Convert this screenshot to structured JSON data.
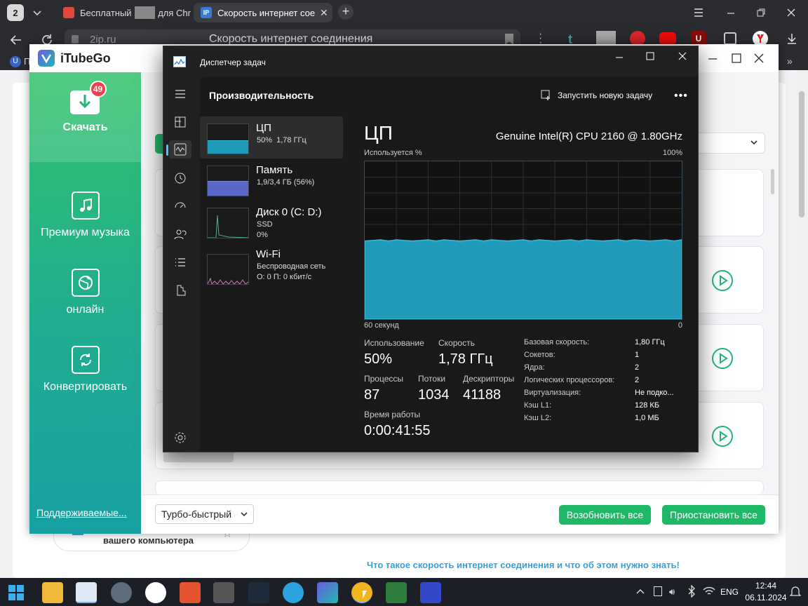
{
  "browser": {
    "tab_count": "2",
    "tabs": [
      {
        "title": "Бесплатный",
        "title_tail": "для Chr"
      },
      {
        "title": "Скорость интернет сое"
      }
    ],
    "address": {
      "domain": "2ip.ru",
      "page_title": "Скорость интернет соединения"
    },
    "bookmark_text": "П"
  },
  "itubego": {
    "app_title": "iTubeGo",
    "nav": [
      {
        "label": "Скачать",
        "badge": "49"
      },
      {
        "label": "Премиум музыка"
      },
      {
        "label": "онлайн"
      },
      {
        "label": "Конвертировать"
      }
    ],
    "supported_link": "Поддерживаемые...",
    "speed_select": "Турбо-быстрый",
    "resume_all": "Возобновить все",
    "pause_all": "Приостановить все"
  },
  "background_page": {
    "sidebar_text": "вашего компьютера",
    "link_text": "Что такое скорость интернет соединения и что об этом нужно знать!"
  },
  "taskmgr": {
    "window_title": "Диспетчер задач",
    "section_title": "Производительность",
    "run_task": "Запустить новую задачу",
    "devices": [
      {
        "name": "ЦП",
        "line1": "50%  1,78 ГГц",
        "line2": ""
      },
      {
        "name": "Память",
        "line1": "1,9/3,4 ГБ (56%)",
        "line2": ""
      },
      {
        "name": "Диск 0 (C: D:)",
        "line1": "SSD",
        "line2": "0%"
      },
      {
        "name": "Wi-Fi",
        "line1": "Беспроводная сеть",
        "line2": "О: 0 П: 0 кбит/с"
      }
    ],
    "cpu": {
      "heading": "ЦП",
      "model": "Genuine Intel(R) CPU 2160 @ 1.80GHz",
      "graph_label": "Используется %",
      "graph_max": "100%",
      "graph_time": "60 секунд",
      "graph_zero": "0",
      "utilization_pct": 50,
      "stats": {
        "usage_label": "Использование",
        "usage": "50%",
        "speed_label": "Скорость",
        "speed": "1,78 ГГц",
        "processes_label": "Процессы",
        "processes": "87",
        "threads_label": "Потоки",
        "threads": "1034",
        "handles_label": "Дескрипторы",
        "handles": "41188",
        "uptime_label": "Время работы",
        "uptime": "0:00:41:55"
      },
      "specs": [
        {
          "k": "Базовая скорость:",
          "v": "1,80 ГГц"
        },
        {
          "k": "Сокетов:",
          "v": "1"
        },
        {
          "k": "Ядра:",
          "v": "2"
        },
        {
          "k": "Логических процессоров:",
          "v": "2"
        },
        {
          "k": "Виртуализация:",
          "v": "Не подко..."
        },
        {
          "k": "Кэш L1:",
          "v": "128 КБ"
        },
        {
          "k": "Кэш L2:",
          "v": "1,0 МБ"
        }
      ]
    }
  },
  "taskbar": {
    "lang": "ENG",
    "time": "12:44",
    "date": "06.11.2024"
  },
  "colors": {
    "cpu_fill": "#1f9ab9",
    "cpu_line": "#3db8d6",
    "mem_fill": "#5a68c8",
    "itubego_green": "#1fb866"
  }
}
